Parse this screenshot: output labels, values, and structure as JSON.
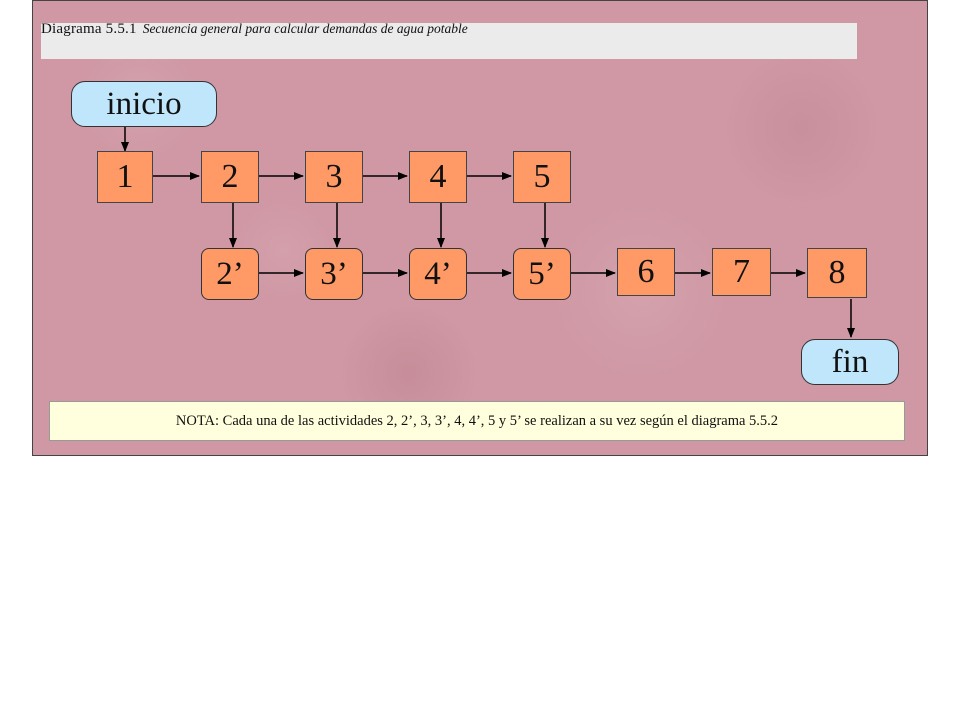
{
  "diagram": {
    "caption": {
      "number": "Diagrama  5.5.1",
      "description": "Secuencia general para calcular demandas de agua potable"
    },
    "start_label": "inicio",
    "end_label": "fin",
    "top_row": [
      "1",
      "2",
      "3",
      "4",
      "5"
    ],
    "bottom_row": [
      "2’",
      "3’",
      "4’",
      "5’",
      "6",
      "7",
      "8"
    ],
    "note": "NOTA: Cada una de las actividades 2, 2’, 3, 3’, 4, 4’, 5 y 5’ se realizan a su vez según el diagrama 5.5.2",
    "colors": {
      "background": "#cf98a4",
      "step_fill": "#ff9966",
      "terminal_fill": "#bfe6fb",
      "note_fill": "#ffffdd",
      "caption_fill": "#ebebeb"
    }
  }
}
